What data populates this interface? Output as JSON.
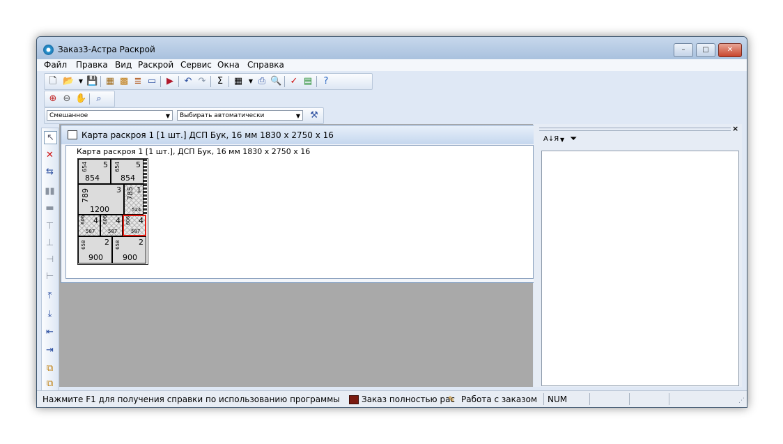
{
  "window": {
    "title": "Заказ3-Астра Раскрой",
    "min_label": "–",
    "max_label": "□",
    "close_label": "✕"
  },
  "menu": [
    "Файл",
    "Правка",
    "Вид",
    "Раскрой",
    "Сервис",
    "Окна",
    "Справка"
  ],
  "toolbar_main": {
    "icons": [
      "new-icon",
      "open-icon",
      "save-icon",
      "catalog-icon",
      "layout-icon",
      "materials-icon",
      "book-icon",
      "run-icon",
      "undo-icon",
      "redo-icon",
      "sum-icon",
      "grid-icon",
      "print-icon",
      "preview-icon",
      "check-icon",
      "optimize-icon",
      "help-icon"
    ]
  },
  "toolbar_zoom": {
    "icons": [
      "zoom-in-icon",
      "zoom-out-icon",
      "pan-hand-icon",
      "zoom-fit-icon"
    ]
  },
  "combos": {
    "mode_value": "Смешанное",
    "select_value": "Выбирать автоматически"
  },
  "child": {
    "title": "Карта раскроя 1 [1 шт.] ДСП Бук, 16 мм 1830 x 2750 x 16",
    "caption": "Карта раскроя 1 [1 шт.], ДСП Бук, 16 мм 1830 x 2750 x 16"
  },
  "parts": [
    {
      "w": "854",
      "h": "654",
      "qty": "5"
    },
    {
      "w": "854",
      "h": "654",
      "qty": "5"
    },
    {
      "w": "1200",
      "h": "789",
      "qty": "3"
    },
    {
      "w": "524",
      "h": "785",
      "qty": "1"
    },
    {
      "w": "587",
      "h": "606",
      "qty": "4"
    },
    {
      "w": "587",
      "h": "606",
      "qty": "4"
    },
    {
      "w": "587",
      "h": "606",
      "qty": "4"
    },
    {
      "w": "900",
      "h": "658",
      "qty": "2"
    },
    {
      "w": "900",
      "h": "658",
      "qty": "2"
    }
  ],
  "right_panel": {
    "sort_label": "А↓Я",
    "close_label": "×"
  },
  "status": {
    "hint": "Нажмите F1 для получения справки по использованию программы",
    "order_status": "Заказ полностью рас",
    "mode": "Работа с заказом",
    "num": "NUM"
  },
  "colors": {
    "selected_part_border": "#e01a10",
    "workspace": "#a9a9a9",
    "titlebar": "#b9cde6"
  }
}
